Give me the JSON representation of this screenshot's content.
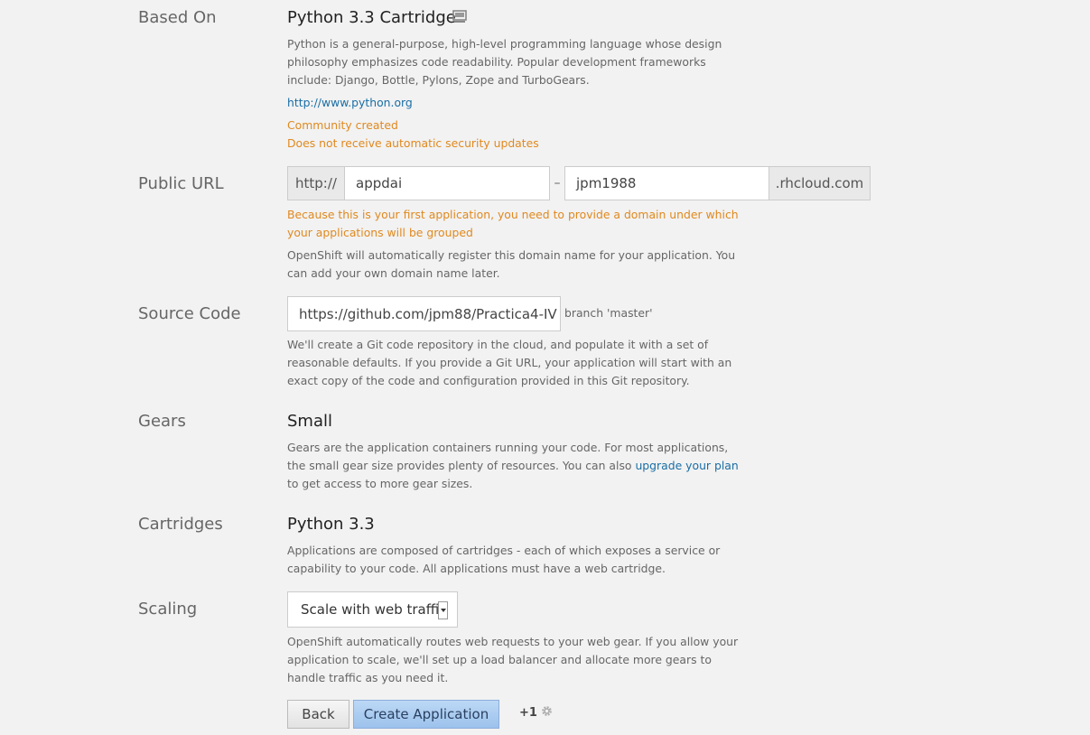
{
  "based_on": {
    "label": "Based On",
    "title": "Python 3.3 Cartridge",
    "description": "Python is a general-purpose, high-level programming language whose design philosophy emphasizes code readability. Popular development frameworks include: Django, Bottle, Pylons, Zope and TurboGears.",
    "link": "http://www.python.org",
    "community": "Community created",
    "security": "Does not receive automatic security updates"
  },
  "public_url": {
    "label": "Public URL",
    "prefix": "http://",
    "app_name": "appdai",
    "dash": "–",
    "namespace": "jpm1988",
    "suffix": ".rhcloud.com",
    "warning": "Because this is your first application, you need to provide a domain under which your applications will be grouped",
    "help": "OpenShift will automatically register this domain name for your application. You can add your own domain name later."
  },
  "source_code": {
    "label": "Source Code",
    "url": "https://github.com/jpm88/Practica4-IV",
    "branch": "branch 'master'",
    "help": "We'll create a Git code repository in the cloud, and populate it with a set of reasonable defaults. If you provide a Git URL, your application will start with an exact copy of the code and configuration provided in this Git repository."
  },
  "gears": {
    "label": "Gears",
    "value": "Small",
    "help_before": "Gears are the application containers running your code. For most applications, the small gear size provides plenty of resources. You can also ",
    "help_link": "upgrade your plan",
    "help_after": " to get access to more gear sizes."
  },
  "cartridges": {
    "label": "Cartridges",
    "value": "Python 3.3",
    "help": "Applications are composed of cartridges - each of which exposes a service or capability to your code. All applications must have a web cartridge."
  },
  "scaling": {
    "label": "Scaling",
    "selected": "Scale with web traffic",
    "help": "OpenShift automatically routes web requests to your web gear. If you allow your application to scale, we'll set up a load balancer and allocate more gears to handle traffic as you need it."
  },
  "actions": {
    "back": "Back",
    "create": "Create Application",
    "gear_cost": "+1"
  },
  "icons": {
    "cartridge": "cartridge-icon",
    "gear": "gear-icon",
    "select_arrow": "chevron-down-icon"
  },
  "colors": {
    "warning": "#e0891f",
    "link": "#1a6ea5",
    "primary_button": "#9cc2ec"
  }
}
